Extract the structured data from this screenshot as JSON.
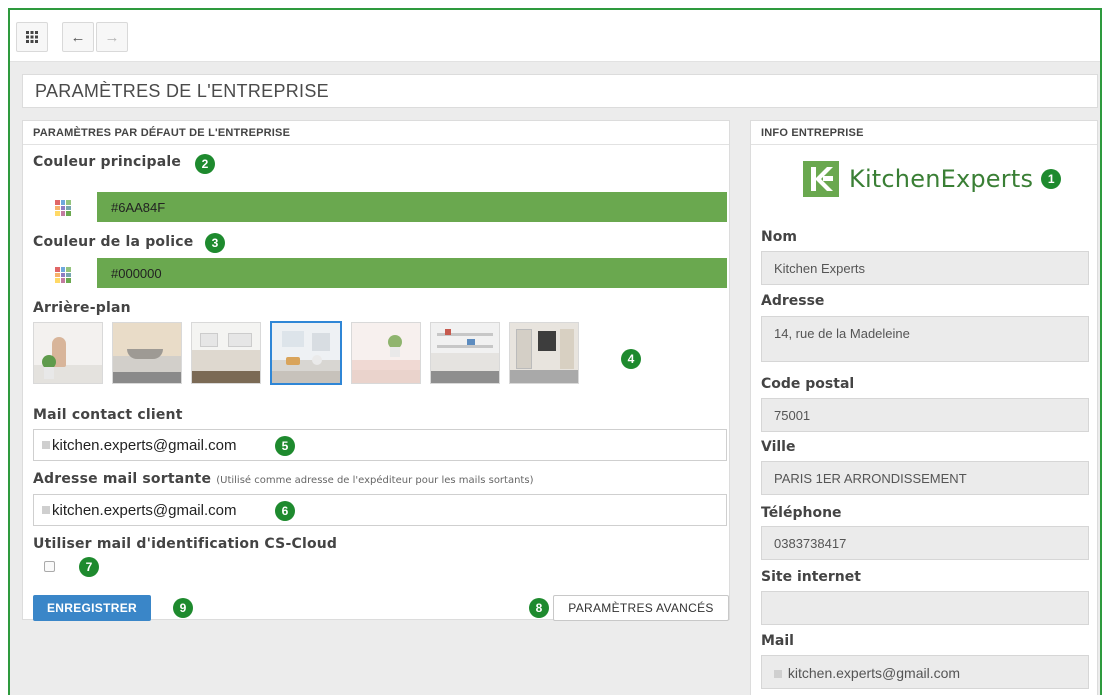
{
  "toolbar": {
    "grid_icon": "apps-grid-icon",
    "back_icon": "arrow-left-icon",
    "forward_icon": "arrow-right-icon"
  },
  "page": {
    "title": "PARAMÈTRES DE L'ENTREPRISE"
  },
  "colors": {
    "accent_green": "#6aa84f",
    "badge_green": "#1e8a2e",
    "frame_green": "#2e9a3e",
    "primary_blue": "#3a86c8",
    "selected_border": "#2f86d6"
  },
  "defaults": {
    "header": "PARAMÈTRES PAR DÉFAUT DE L'ENTREPRISE",
    "primary_color": {
      "label": "Couleur principale",
      "badge": "2",
      "value": "#6AA84F"
    },
    "font_color": {
      "label": "Couleur de la police",
      "badge": "3",
      "value": "#000000"
    },
    "background": {
      "label": "Arrière-plan",
      "badge": "4",
      "thumbnails": [
        {
          "name": "kitchen-wood-board",
          "selected": false
        },
        {
          "name": "kitchen-sink-counter",
          "selected": false
        },
        {
          "name": "kitchen-white-cabinets",
          "selected": false
        },
        {
          "name": "kitchen-bright-counter",
          "selected": true
        },
        {
          "name": "kitchen-plant-counter",
          "selected": false
        },
        {
          "name": "kitchen-shelves",
          "selected": false
        },
        {
          "name": "kitchen-open-shelving",
          "selected": false
        }
      ]
    },
    "contact_mail": {
      "label": "Mail contact client",
      "badge": "5",
      "value": "kitchen.experts@gmail.com"
    },
    "outgoing_mail": {
      "label": "Adresse mail sortante",
      "hint": "(Utilisé comme adresse de l'expéditeur pour les mails sortants)",
      "badge": "6",
      "value": "kitchen.experts@gmail.com"
    },
    "cs_cloud": {
      "label": "Utiliser mail d'identification CS-Cloud",
      "badge": "7",
      "checked": false
    },
    "advanced_button": {
      "label": "PARAMÈTRES AVANCÉS",
      "badge": "8"
    },
    "save_button": {
      "label": "ENREGISTRER",
      "badge": "9"
    }
  },
  "company_info": {
    "header": "INFO ENTREPRISE",
    "logo_text": "KitchenExperts",
    "logo_badge": "1",
    "fields": {
      "nom": {
        "label": "Nom",
        "value": "Kitchen Experts"
      },
      "adresse": {
        "label": "Adresse",
        "value": "14, rue de la Madeleine"
      },
      "code_postal": {
        "label": "Code postal",
        "value": "75001"
      },
      "ville": {
        "label": "Ville",
        "value": "PARIS 1ER ARRONDISSEMENT"
      },
      "telephone": {
        "label": "Téléphone",
        "value": "0383738417"
      },
      "site": {
        "label": "Site internet",
        "value": ""
      },
      "mail": {
        "label": "Mail",
        "value": "kitchen.experts@gmail.com"
      }
    }
  }
}
